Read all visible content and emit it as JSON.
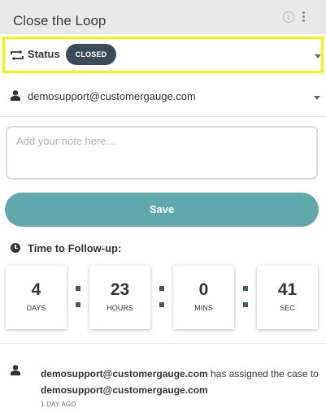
{
  "header": {
    "title": "Close the Loop",
    "info_icon": "info-icon",
    "menu_icon": "kebab-menu-icon",
    "info_glyph": "i"
  },
  "status": {
    "label": "Status",
    "value": "CLOSED",
    "icon": "repeat-icon",
    "badge_color": "#3d4b57",
    "highlight_color": "#f7f400"
  },
  "assignee": {
    "icon": "user-icon",
    "value": "demosupport@customergauge.com"
  },
  "note": {
    "value": "",
    "placeholder": "Add your note here..."
  },
  "save": {
    "label": "Save",
    "color": "#5fa9ad"
  },
  "followup": {
    "icon": "clock-icon",
    "label": "Time to Follow-up:",
    "timer": [
      {
        "value": "4",
        "unit": "DAYS"
      },
      {
        "value": "23",
        "unit": "HOURS"
      },
      {
        "value": "0",
        "unit": "MINS"
      },
      {
        "value": "41",
        "unit": "SEC"
      }
    ]
  },
  "activity": [
    {
      "icon": "user-icon",
      "actor": "demosupport@customergauge.com",
      "action": "has assigned the case to",
      "target": "demosupport@customergauge.com",
      "time": "1 DAY AGO"
    }
  ]
}
